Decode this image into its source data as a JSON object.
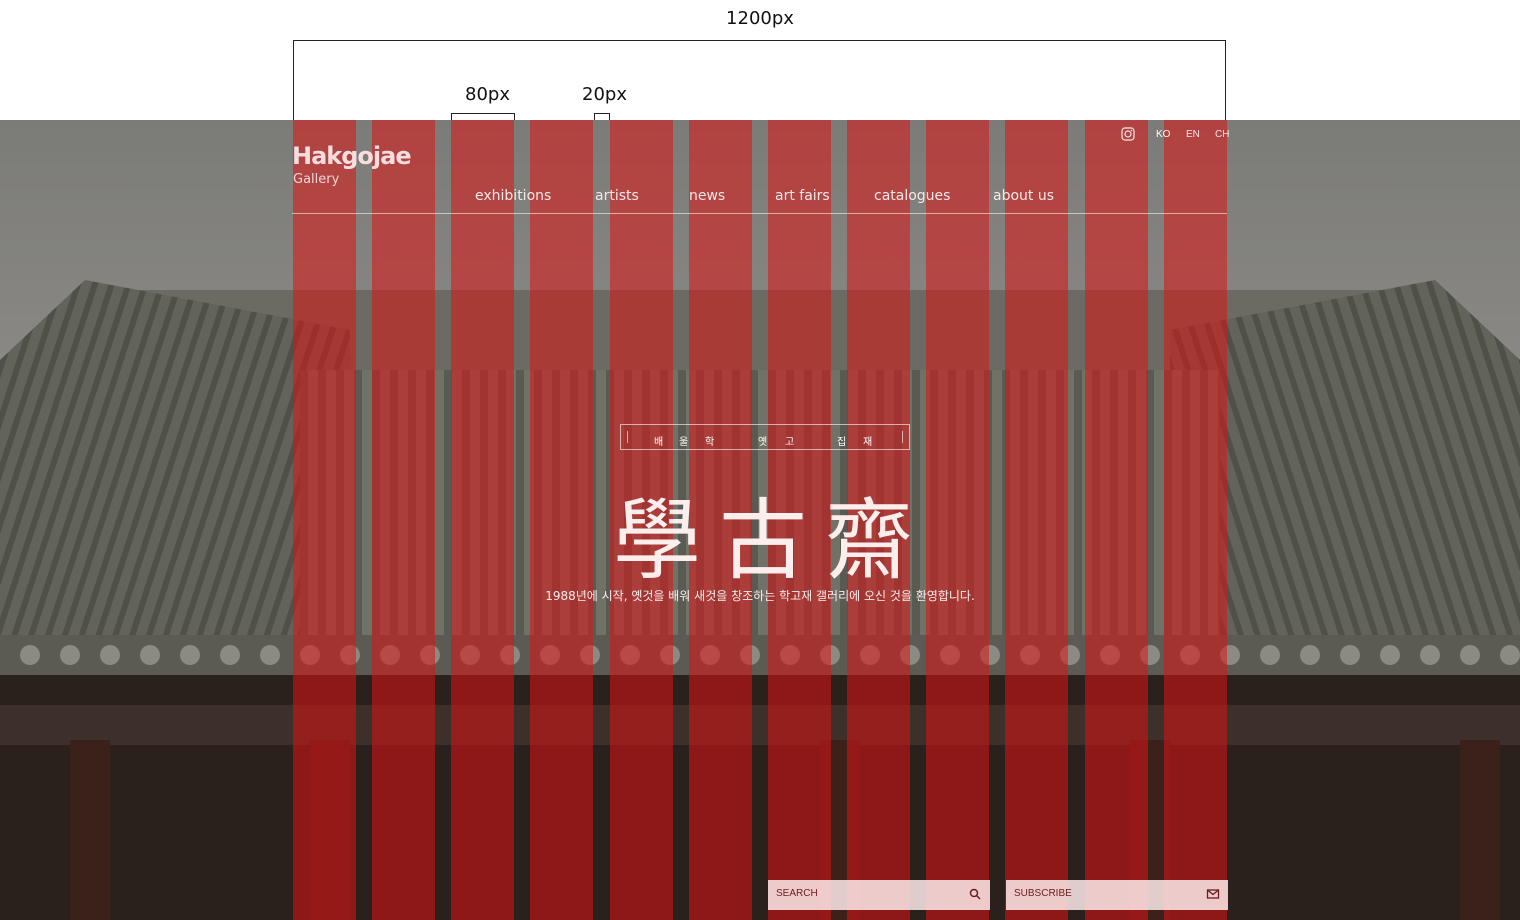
{
  "spec": {
    "container_width_label": "1200px",
    "column_width_label": "80px",
    "gutter_width_label": "20px"
  },
  "logo": {
    "name": "Hakgojae",
    "sub": "Gallery"
  },
  "languages": [
    "KO",
    "EN",
    "CH"
  ],
  "nav": [
    "exhibitions",
    "artists",
    "news",
    "art fairs",
    "catalogues",
    "about us"
  ],
  "hero": {
    "subtitle_chars": [
      "배",
      "울",
      "학",
      "옛",
      "고",
      "집",
      "재"
    ],
    "big_title": "學古齋",
    "tagline": "1988년에 시작, 옛것을 배워 새것을 창조하는 학고재 갤러리에 오신 것을 환영합니다."
  },
  "inputs": {
    "search_label": "SEARCH",
    "subscribe_label": "SUBSCRIBE"
  },
  "colors": {
    "grid_overlay": "#dc1414",
    "text_light": "#fdeeee"
  }
}
